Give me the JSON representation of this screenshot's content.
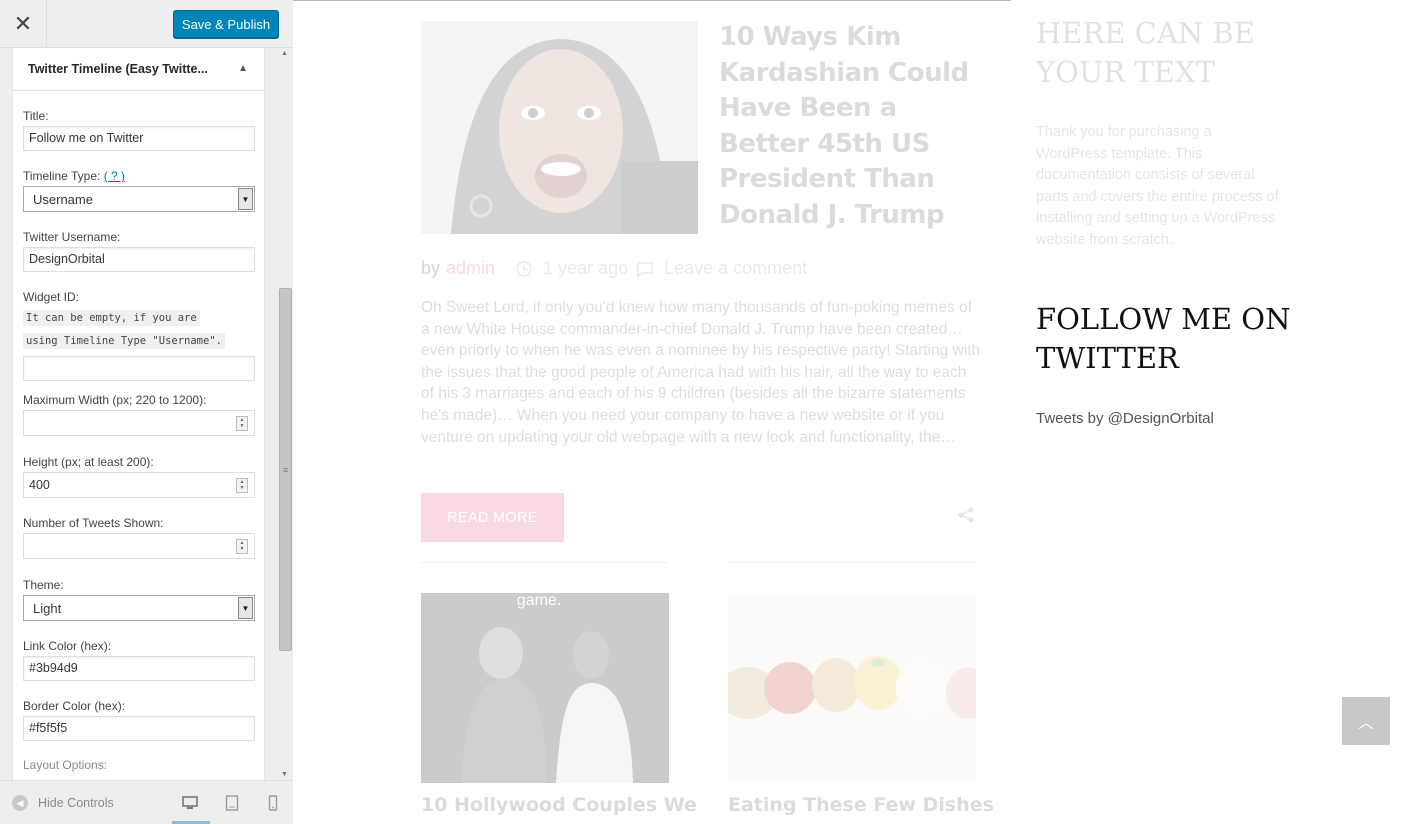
{
  "customizer": {
    "close_icon": "close-icon",
    "save_label": "Save & Publish",
    "widget": {
      "title": "Twitter Timeline (Easy Twitte...",
      "fields": {
        "title_label": "Title:",
        "title_value": "Follow me on Twitter",
        "timeline_type_label": "Timeline Type:",
        "timeline_type_help": "( ? )",
        "timeline_type_value": "Username",
        "username_label": "Twitter Username:",
        "username_value": "DesignOrbital",
        "widget_id_label": "Widget ID:",
        "widget_id_note_line1": "It can be empty, if you are",
        "widget_id_note_line2": "using Timeline Type \"Username\".",
        "widget_id_value": "",
        "max_width_label": "Maximum Width (px; 220 to 1200):",
        "max_width_value": "",
        "height_label": "Height (px; at least 200):",
        "height_value": "400",
        "tweets_shown_label": "Number of Tweets Shown:",
        "tweets_shown_value": "",
        "theme_label": "Theme:",
        "theme_value": "Light",
        "link_color_label": "Link Color (hex):",
        "link_color_value": "#3b94d9",
        "border_color_label": "Border Color (hex):",
        "border_color_value": "#f5f5f5",
        "layout_options_label": "Layout Options:"
      }
    },
    "footer": {
      "hide_controls_label": "Hide Controls"
    }
  },
  "preview": {
    "post": {
      "title": "10 Ways Kim Kardashian Could Have Been a Better 45th US President Than Donald J. Trump",
      "meta_by": "by",
      "meta_author": "admin",
      "meta_time": "1 year ago",
      "meta_comment": "Leave a comment",
      "excerpt": "Oh Sweet Lord, if only you'd knew how many thousands of fun-poking memes of a new White House commander-in-chief Donald J. Trump have been created… even priorly to when he was even a nominee by his respective party! Starting with the issues that the good people of America had with his hair, all the way to each of his 3 marriages and each of his 9 children (besides all the bizarre statements he's made)… When you need your company to have a new website or if you venture on updating your old webpage with a new look and functionality, the…",
      "read_more": "READ MORE"
    },
    "cards": [
      {
        "title": "10 Hollywood Couples We",
        "image_text": "game."
      },
      {
        "title": "Eating These Few Dishes"
      }
    ],
    "sidebar": {
      "heading1": "HERE CAN BE YOUR TEXT",
      "text": "Thank you for purchasing a WordPress template. This documentation consists of several parts and covers the entire process of installing and setting up a WordPress website from scratch.",
      "heading2": "FOLLOW ME ON TWITTER",
      "tweets_by": "Tweets by @DesignOrbital"
    }
  },
  "colors": {
    "primary_button": "#0085ba",
    "accent_pink": "#e1548b",
    "help_link": "#0073aa"
  }
}
